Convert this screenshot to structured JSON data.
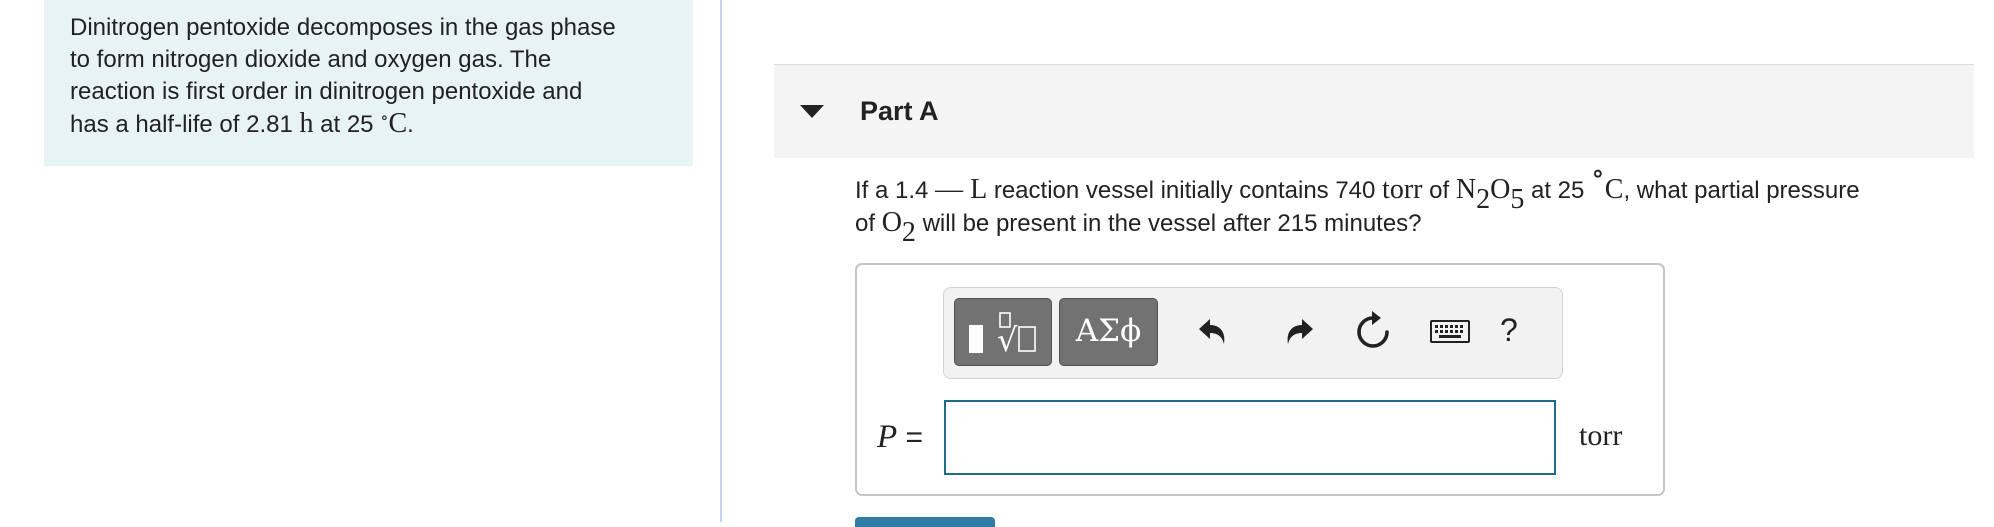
{
  "intro": {
    "line1": "Dinitrogen pentoxide decomposes in the gas phase",
    "line2": "to form nitrogen dioxide and oxygen gas. The",
    "line3": "reaction is first order in dinitrogen pentoxide and",
    "line4_a": "has a half-life of 2.81 ",
    "line4_unit_h": "h",
    "line4_b": " at 25 ",
    "line4_degree": "∘",
    "line4_unit_c": "C",
    "line4_end": "."
  },
  "part": {
    "title": "Part A"
  },
  "question": {
    "t1": "If a 1.4 ",
    "dash": "—",
    "unit_l": " L",
    "t2": " reaction vessel initially contains 740 ",
    "unit_torr": "torr",
    "t3": " of ",
    "n": "N",
    "n_sub": "2",
    "o": "O",
    "o_sub": "5",
    "t4": " at 25 ",
    "degree": "∘",
    "unit_c": "C",
    "t5": ", what partial pressure",
    "t6": "of ",
    "o2": "O",
    "o2_sub": "2",
    "t7": " will be present in the vessel after 215 minutes?"
  },
  "toolbar": {
    "templates_icon": "templates-icon",
    "symbols_label": "ΑΣϕ",
    "undo_icon": "undo-icon",
    "redo_icon": "redo-icon",
    "reset_icon": "reset-icon",
    "keyboard_icon": "keyboard-icon",
    "help_label": "?"
  },
  "answer": {
    "variable": "P",
    "equals": " =",
    "value": "",
    "unit": "torr"
  },
  "colors": {
    "intro_bg": "#e8f3f5",
    "input_border": "#1f6b8a",
    "button_dark": "#727272",
    "submit": "#2e7da3"
  }
}
